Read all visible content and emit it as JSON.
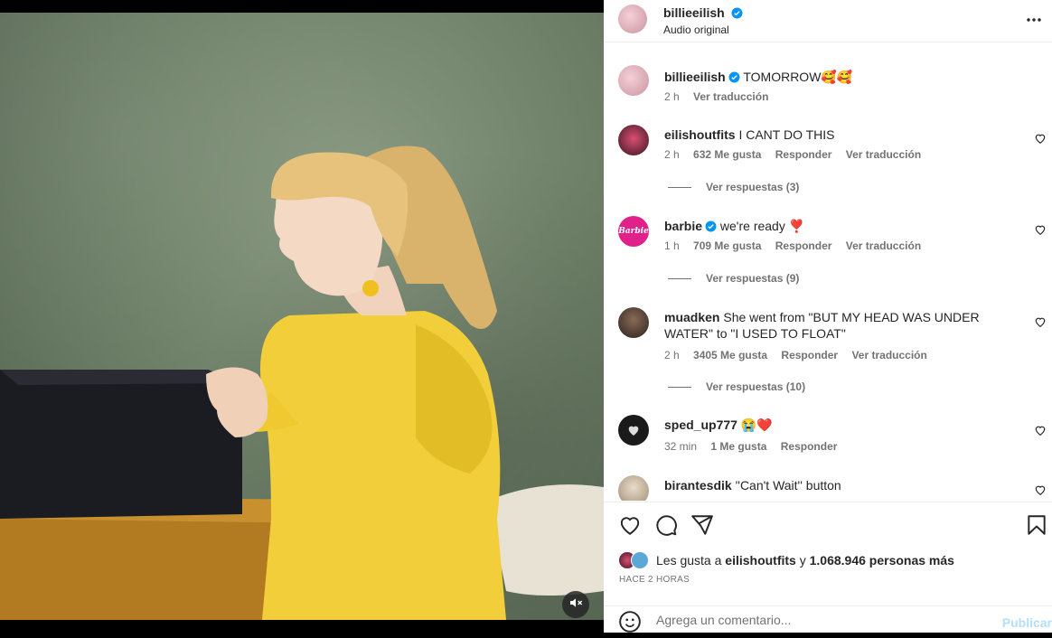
{
  "header": {
    "username": "billieeilish",
    "subtitle": "Audio original"
  },
  "caption": {
    "username": "billieeilish",
    "text": "TOMORROW🥰🥰",
    "time": "2 h",
    "translate": "Ver traducción"
  },
  "comments": [
    {
      "username": "eilishoutfits",
      "text": "I CANT DO THIS",
      "time": "2 h",
      "likes": "632 Me gusta",
      "reply": "Responder",
      "translate": "Ver traducción",
      "replies": "Ver respuestas (3)"
    },
    {
      "username": "barbie",
      "text": "we're ready ❣️",
      "time": "1 h",
      "likes": "709 Me gusta",
      "reply": "Responder",
      "translate": "Ver traducción",
      "replies": "Ver respuestas (9)",
      "avatar_text": "Barbie"
    },
    {
      "username": "muadken",
      "text": "She went from \"BUT MY HEAD WAS UNDER WATER\" to \"I USED TO FLOAT\"",
      "time": "2 h",
      "likes": "3405 Me gusta",
      "reply": "Responder",
      "translate": "Ver traducción",
      "replies": "Ver respuestas (10)"
    },
    {
      "username": "sped_up777",
      "text": "😭❤️",
      "time": "32 min",
      "likes": "1 Me gusta",
      "reply": "Responder"
    },
    {
      "username": "birantesdik",
      "text": "''Can't Wait'' button"
    }
  ],
  "likes": {
    "prefix": "Les gusta a",
    "user": "eilishoutfits",
    "joiner": "y",
    "others": "1.068.946 personas más"
  },
  "timestamp": "HACE 2 HORAS",
  "add_comment": {
    "placeholder": "Agrega un comentario...",
    "publish": "Publicar"
  },
  "colors": {
    "verified": "#0095f6",
    "publish_disabled": "#b2dffc",
    "barbie_pink": "#e0218a"
  },
  "icons": [
    "more-options-icon",
    "verified-icon",
    "heart-icon",
    "comment-icon",
    "share-icon",
    "bookmark-icon",
    "emoji-icon",
    "muted-icon"
  ]
}
